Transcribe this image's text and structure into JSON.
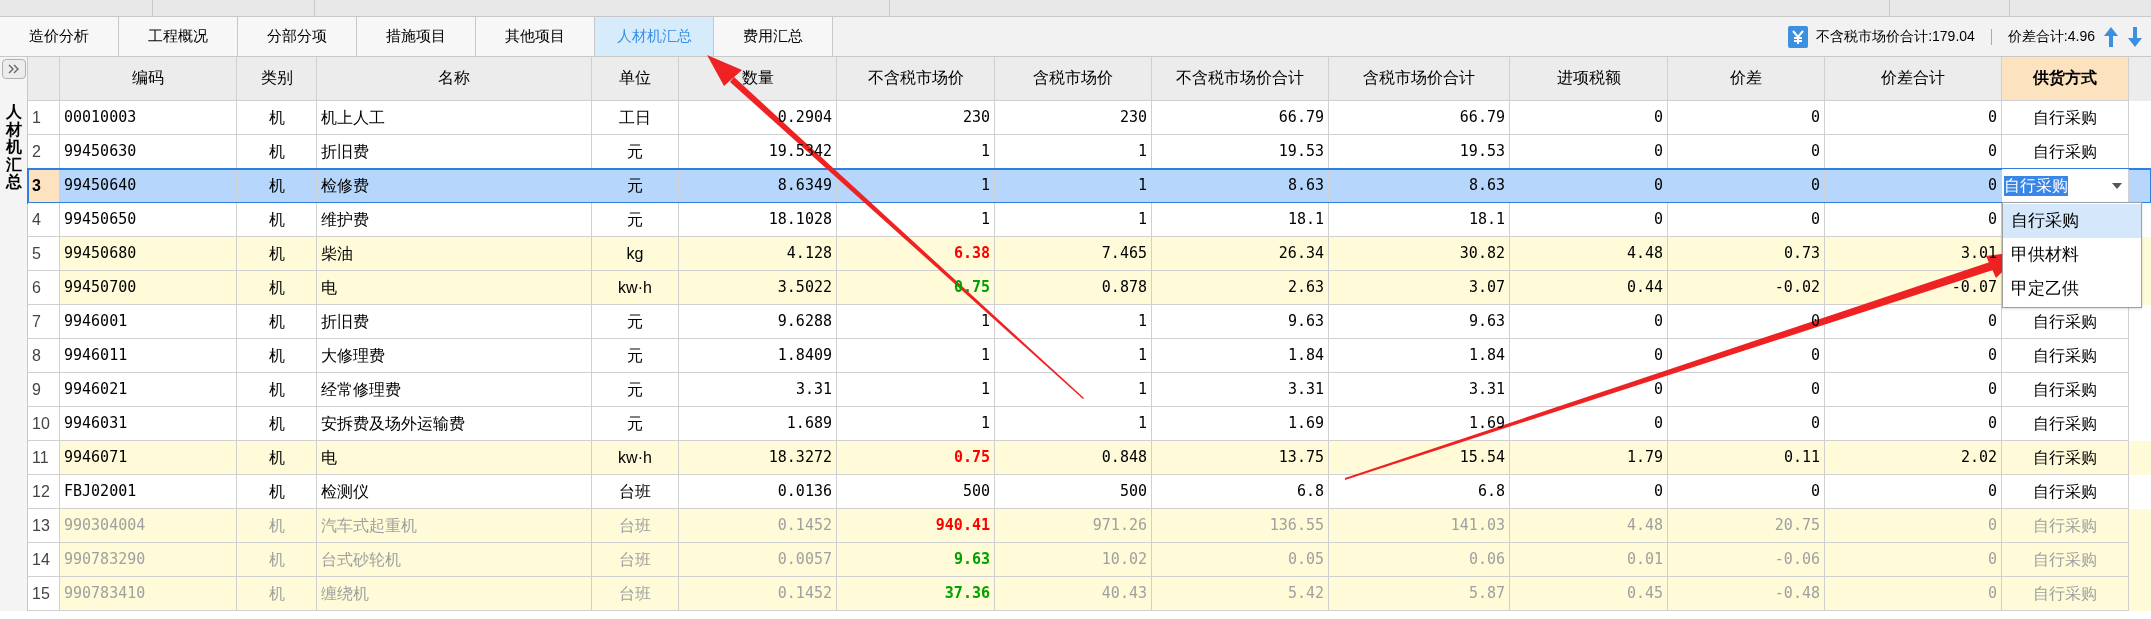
{
  "tabs": [
    {
      "label": "造价分析",
      "selected": false
    },
    {
      "label": "工程概况",
      "selected": false
    },
    {
      "label": "分部分项",
      "selected": false
    },
    {
      "label": "措施项目",
      "selected": false
    },
    {
      "label": "其他项目",
      "selected": false
    },
    {
      "label": "人材机汇总",
      "selected": true
    },
    {
      "label": "费用汇总",
      "selected": false
    }
  ],
  "summary": {
    "total_ex_tax": "不含税市场价合计:179.04",
    "diff_total": "价差合计:4.96"
  },
  "side_panel": {
    "title": "人材机汇总"
  },
  "columns": [
    {
      "label": "编码",
      "selected": false
    },
    {
      "label": "类别",
      "selected": false
    },
    {
      "label": "名称",
      "selected": false
    },
    {
      "label": "单位",
      "selected": false
    },
    {
      "label": "数量",
      "selected": false
    },
    {
      "label": "不含税市场价",
      "selected": false
    },
    {
      "label": "含税市场价",
      "selected": false
    },
    {
      "label": "不含税市场价合计",
      "selected": false
    },
    {
      "label": "含税市场价合计",
      "selected": false
    },
    {
      "label": "进项税额",
      "selected": false
    },
    {
      "label": "价差",
      "selected": false
    },
    {
      "label": "价差合计",
      "selected": false
    },
    {
      "label": "供货方式",
      "selected": true
    }
  ],
  "rows": [
    {
      "no": "1",
      "code": "00010003",
      "type": "机",
      "name": "机上人工",
      "unit": "工日",
      "qty": "0.2904",
      "price_ex": "230",
      "price_in": "230",
      "total_ex": "66.79",
      "total_in": "66.79",
      "tax": "0",
      "diff": "0",
      "diff_total": "0",
      "supply": "自行采购",
      "selected": false,
      "changed": false,
      "disabled": false
    },
    {
      "no": "2",
      "code": "99450630",
      "type": "机",
      "name": "折旧费",
      "unit": "元",
      "qty": "19.5342",
      "price_ex": "1",
      "price_in": "1",
      "total_ex": "19.53",
      "total_in": "19.53",
      "tax": "0",
      "diff": "0",
      "diff_total": "0",
      "supply": "自行采购",
      "selected": false,
      "changed": false,
      "disabled": false
    },
    {
      "no": "3",
      "code": "99450640",
      "type": "机",
      "name": "检修费",
      "unit": "元",
      "qty": "8.6349",
      "price_ex": "1",
      "price_in": "1",
      "total_ex": "8.63",
      "total_in": "8.63",
      "tax": "0",
      "diff": "0",
      "diff_total": "0",
      "supply": "自行采购",
      "selected": true,
      "disabled": false,
      "supply_menu": {
        "options": [
          {
            "label": "自行采购",
            "selected": true
          },
          {
            "label": "甲供材料",
            "selected": false
          },
          {
            "label": "甲定乙供",
            "selected": false
          }
        ]
      }
    },
    {
      "no": "4",
      "code": "99450650",
      "type": "机",
      "name": "维护费",
      "unit": "元",
      "qty": "18.1028",
      "price_ex": "1",
      "price_in": "1",
      "total_ex": "18.1",
      "total_in": "18.1",
      "tax": "0",
      "diff": "0",
      "diff_total": "0",
      "selected": false,
      "changed": false,
      "disabled": false
    },
    {
      "no": "5",
      "code": "99450680",
      "type": "机",
      "name": "柴油",
      "unit": "kg",
      "qty": "4.128",
      "price_ex": {
        "value": "6.38",
        "color": "#ff0000"
      },
      "price_in": "7.465",
      "total_ex": "26.34",
      "total_in": "30.82",
      "tax": "4.48",
      "diff": "0.73",
      "diff_total": "3.01",
      "selected": false,
      "changed": true,
      "disabled": false
    },
    {
      "no": "6",
      "code": "99450700",
      "type": "机",
      "name": "电",
      "unit": "kw·h",
      "qty": "3.5022",
      "price_ex": {
        "value": "0.75",
        "color": "#00a000"
      },
      "price_in": "0.878",
      "total_ex": "2.63",
      "total_in": "3.07",
      "tax": "0.44",
      "diff": "-0.02",
      "diff_total": "-0.07",
      "selected": false,
      "changed": true,
      "disabled": false
    },
    {
      "no": "7",
      "code": "9946001",
      "type": "机",
      "name": "折旧费",
      "unit": "元",
      "qty": "9.6288",
      "price_ex": "1",
      "price_in": "1",
      "total_ex": "9.63",
      "total_in": "9.63",
      "tax": "0",
      "diff": "0",
      "diff_total": "0",
      "supply": "自行采购",
      "selected": false,
      "changed": false,
      "disabled": false
    },
    {
      "no": "8",
      "code": "9946011",
      "type": "机",
      "name": "大修理费",
      "unit": "元",
      "qty": "1.8409",
      "price_ex": "1",
      "price_in": "1",
      "total_ex": "1.84",
      "total_in": "1.84",
      "tax": "0",
      "diff": "0",
      "diff_total": "0",
      "supply": "自行采购",
      "selected": false,
      "changed": false,
      "disabled": false
    },
    {
      "no": "9",
      "code": "9946021",
      "type": "机",
      "name": "经常修理费",
      "unit": "元",
      "qty": "3.31",
      "price_ex": "1",
      "price_in": "1",
      "total_ex": "3.31",
      "total_in": "3.31",
      "tax": "0",
      "diff": "0",
      "diff_total": "0",
      "supply": "自行采购",
      "selected": false,
      "changed": false,
      "disabled": false
    },
    {
      "no": "10",
      "code": "9946031",
      "type": "机",
      "name": "安拆费及场外运输费",
      "unit": "元",
      "qty": "1.689",
      "price_ex": "1",
      "price_in": "1",
      "total_ex": "1.69",
      "total_in": "1.69",
      "tax": "0",
      "diff": "0",
      "diff_total": "0",
      "supply": "自行采购",
      "selected": false,
      "changed": false,
      "disabled": false
    },
    {
      "no": "11",
      "code": "9946071",
      "type": "机",
      "name": "电",
      "unit": "kw·h",
      "qty": "18.3272",
      "price_ex": {
        "value": "0.75",
        "color": "#ff0000"
      },
      "price_in": "0.848",
      "total_ex": "13.75",
      "total_in": "15.54",
      "tax": "1.79",
      "diff": "0.11",
      "diff_total": "2.02",
      "supply": "自行采购",
      "selected": false,
      "changed": true,
      "disabled": false
    },
    {
      "no": "12",
      "code": "FBJ02001",
      "type": "机",
      "name": "检测仪",
      "unit": "台班",
      "qty": "0.0136",
      "price_ex": "500",
      "price_in": "500",
      "total_ex": "6.8",
      "total_in": "6.8",
      "tax": "0",
      "diff": "0",
      "diff_total": "0",
      "supply": "自行采购",
      "selected": false,
      "changed": false,
      "disabled": false
    },
    {
      "no": "13",
      "code": "990304004",
      "type": "机",
      "name": "汽车式起重机",
      "unit": "台班",
      "qty": "0.1452",
      "price_ex": {
        "value": "940.41",
        "color": "#ff0000"
      },
      "price_in": "971.26",
      "total_ex": "136.55",
      "total_in": "141.03",
      "tax": "4.48",
      "diff": "20.75",
      "diff_total": "0",
      "supply": "自行采购",
      "selected": false,
      "changed": true,
      "disabled": true
    },
    {
      "no": "14",
      "code": "990783290",
      "type": "机",
      "name": "台式砂轮机",
      "unit": "台班",
      "qty": "0.0057",
      "price_ex": {
        "value": "9.63",
        "color": "#00a000"
      },
      "price_in": "10.02",
      "total_ex": "0.05",
      "total_in": "0.06",
      "tax": "0.01",
      "diff": "-0.06",
      "diff_total": "0",
      "supply": "自行采购",
      "selected": false,
      "changed": true,
      "disabled": true
    },
    {
      "no": "15",
      "code": "990783410",
      "type": "机",
      "name": "缠绕机",
      "unit": "台班",
      "qty": "0.1452",
      "price_ex": {
        "value": "37.36",
        "color": "#00a000"
      },
      "price_in": "40.43",
      "total_ex": "5.42",
      "total_in": "5.87",
      "tax": "0.45",
      "diff": "-0.48",
      "diff_total": "0",
      "supply": "自行采购",
      "selected": false,
      "changed": true,
      "disabled": true
    }
  ]
}
